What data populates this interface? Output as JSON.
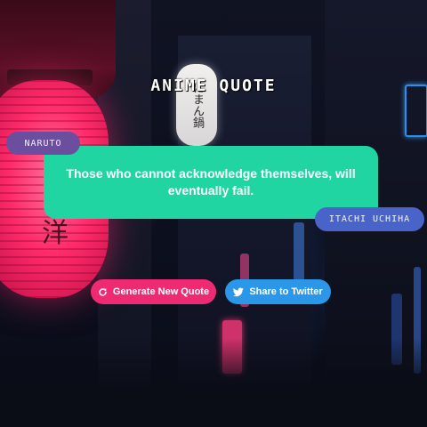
{
  "app": {
    "title": "ANIME QUOTE"
  },
  "quote": {
    "text": "Those who cannot acknowledge themselves, will eventually fail.",
    "anime": "NARUTO",
    "character": "ITACHI UCHIHA"
  },
  "actions": {
    "generate_label": "Generate New Quote",
    "generate_icon": "refresh-icon",
    "share_label": "Share to Twitter",
    "share_icon": "twitter-icon"
  },
  "colors": {
    "quote_card": "#20d5a2",
    "anime_tag": "#6c4e9e",
    "character_tag": "#4a63c8",
    "generate_button": "#ee2a73",
    "share_button": "#2a97e8"
  }
}
